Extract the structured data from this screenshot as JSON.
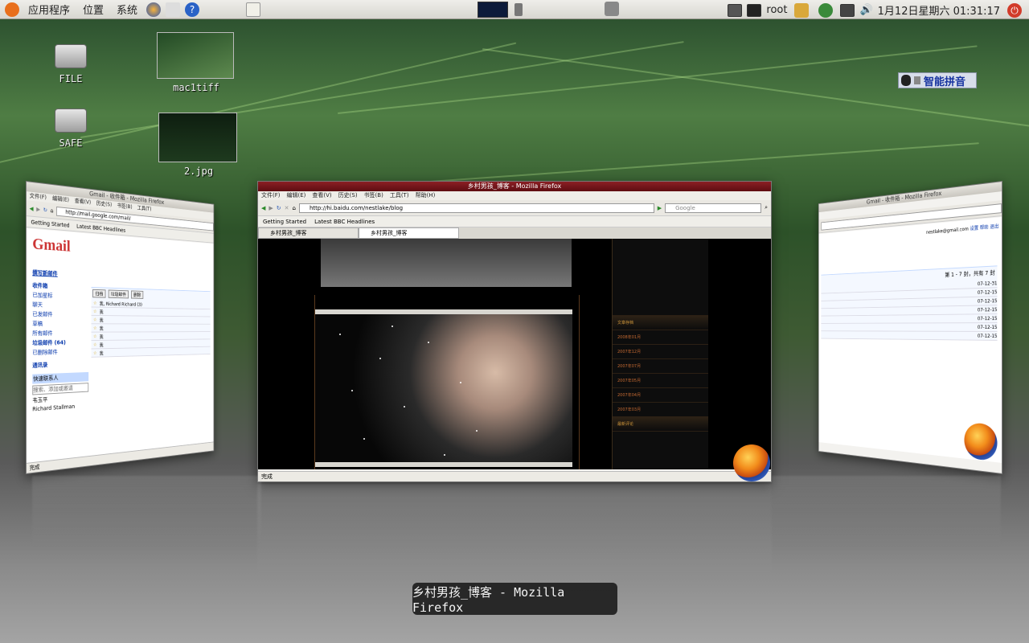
{
  "panel": {
    "menus": [
      "应用程序",
      "位置",
      "系统"
    ],
    "user": "root",
    "clock": "1月12日星期六 01:31:17"
  },
  "desktop": {
    "icons": [
      "FILE",
      "mac1tiff",
      "SAFE",
      "2.jpg"
    ],
    "ime_label": "智能拼音"
  },
  "windows": {
    "left": {
      "title": "Gmail - 收件箱 - Mozilla Firefox",
      "menu": [
        "文件(F)",
        "编辑(E)",
        "查看(V)",
        "历史(S)",
        "书签(B)",
        "工具(T)"
      ],
      "url": "http://mail.google.com/mail/",
      "bookmarks": [
        "Getting Started",
        "Latest BBC Headlines"
      ],
      "gmail": {
        "logo": "Gmail",
        "compose": "撰写新邮件",
        "nav": [
          "收件箱",
          "已加星标",
          "聊天",
          "已发邮件",
          "草稿",
          "所有邮件",
          "垃圾邮件 (64)",
          "已删除邮件",
          "通讯录"
        ],
        "senders": [
          "我, Richard Richard (3)",
          "我",
          "我",
          "我",
          "我",
          "我",
          "我"
        ],
        "contacts_header": "快速联系人",
        "contact_search": "搜索、添加或邀请",
        "contacts": [
          "韦玉平",
          "Richard Stallman"
        ],
        "buttons": [
          "归档",
          "垃圾邮件",
          "删除"
        ],
        "status": "完成"
      }
    },
    "center": {
      "title": "乡村男孩_博客 - Mozilla Firefox",
      "menu": [
        "文件(F)",
        "编辑(E)",
        "查看(V)",
        "历史(S)",
        "书签(B)",
        "工具(T)",
        "帮助(H)"
      ],
      "url": "http://hi.baidu.com/nestlake/blog",
      "search_placeholder": "Google",
      "bookmarks": [
        "Getting Started",
        "Latest BBC Headlines"
      ],
      "tabs": [
        "乡村男孩_博客",
        "乡村男孩_博客"
      ],
      "sidebar": {
        "archive_header": "文章存档",
        "archive": [
          "2008年01月",
          "2007年12月",
          "2007年07月",
          "2007年05月",
          "2007年04月",
          "2007年03月"
        ],
        "comments_header": "最新评论"
      },
      "status": "完成"
    },
    "right": {
      "title": "Gmail - 收件箱 - Mozilla Firefox",
      "email": "nestlake@gmail.com",
      "links": [
        "设置",
        "帮助",
        "退出"
      ],
      "range": "第 1 - 7 封，共有 7 封",
      "dates": [
        "07-12-31",
        "07-12-15",
        "07-12-15",
        "07-12-15",
        "07-12-15",
        "07-12-15",
        "07-12-15"
      ]
    }
  },
  "switcher_caption": "乡村男孩_博客 - Mozilla Firefox",
  "colors": {
    "panel": "#e4e2dc",
    "titlebar": "#7a161b",
    "caption_bg": "#1e1e1e",
    "link": "#0033aa"
  }
}
